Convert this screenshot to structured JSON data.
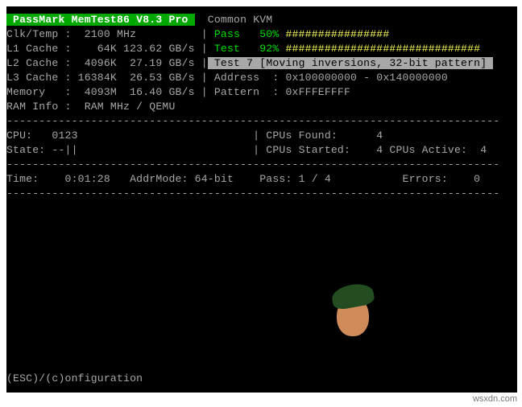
{
  "header": {
    "title": " PassMark MemTest86 V8.3 Pro ",
    "machine": "  Common KVM"
  },
  "lines": {
    "clk": "Clk/Temp :  2100 MHz          | ",
    "clk_pass_label": "Pass   ",
    "clk_pass_pct": "50% ",
    "clk_pass_bar": "################",
    "l1": "L1 Cache :    64K 123.62 GB/s | ",
    "l1_test_label": "Test   ",
    "l1_test_pct": "92% ",
    "l1_test_bar": "##############################",
    "l2a": "L2 Cache :  4096K  27.19 GB/s |",
    "l2b": " Test 7 [Moving inversions, 32-bit pattern] ",
    "l3": "L3 Cache : 16384K  26.53 GB/s | Address  : 0x100000000 - 0x140000000",
    "mem": "Memory   :  4093M  16.40 GB/s | Pattern  : 0xFFFEFFFF",
    "ram": "RAM Info :  RAM MHz / QEMU",
    "sep": "----------------------------------------------------------------------------",
    "cpu": "CPU:   0123                           | CPUs Found:      4",
    "state": "State: --||                           | CPUs Started:    4 CPUs Active:  4",
    "time": "Time:    0:01:28   AddrMode: 64-bit    Pass: 1 / 4           Errors:    0"
  },
  "footer": "(ESC)/(c)onfiguration",
  "chart_data": {
    "type": "table",
    "title": "PassMark MemTest86 V8.3 Pro — Common KVM",
    "system": {
      "clock_mhz": 2100,
      "l1_cache_kb": 64,
      "l1_bw_gbs": 123.62,
      "l2_cache_kb": 4096,
      "l2_bw_gbs": 27.19,
      "l3_cache_kb": 16384,
      "l3_bw_gbs": 26.53,
      "memory_mb": 4093,
      "memory_bw_gbs": 16.4,
      "ram_info": "RAM MHz / QEMU"
    },
    "progress": {
      "pass_pct": 50,
      "test_pct": 92,
      "current_test": "Test 7 [Moving inversions, 32-bit pattern]",
      "address_range": "0x100000000 - 0x140000000",
      "pattern": "0xFFFEFFFF"
    },
    "cpus": {
      "ids": "0123",
      "found": 4,
      "started": 4,
      "active": 4,
      "state": "--||"
    },
    "run": {
      "time": "0:01:28",
      "addr_mode": "64-bit",
      "pass": "1 / 4",
      "errors": 0
    }
  }
}
